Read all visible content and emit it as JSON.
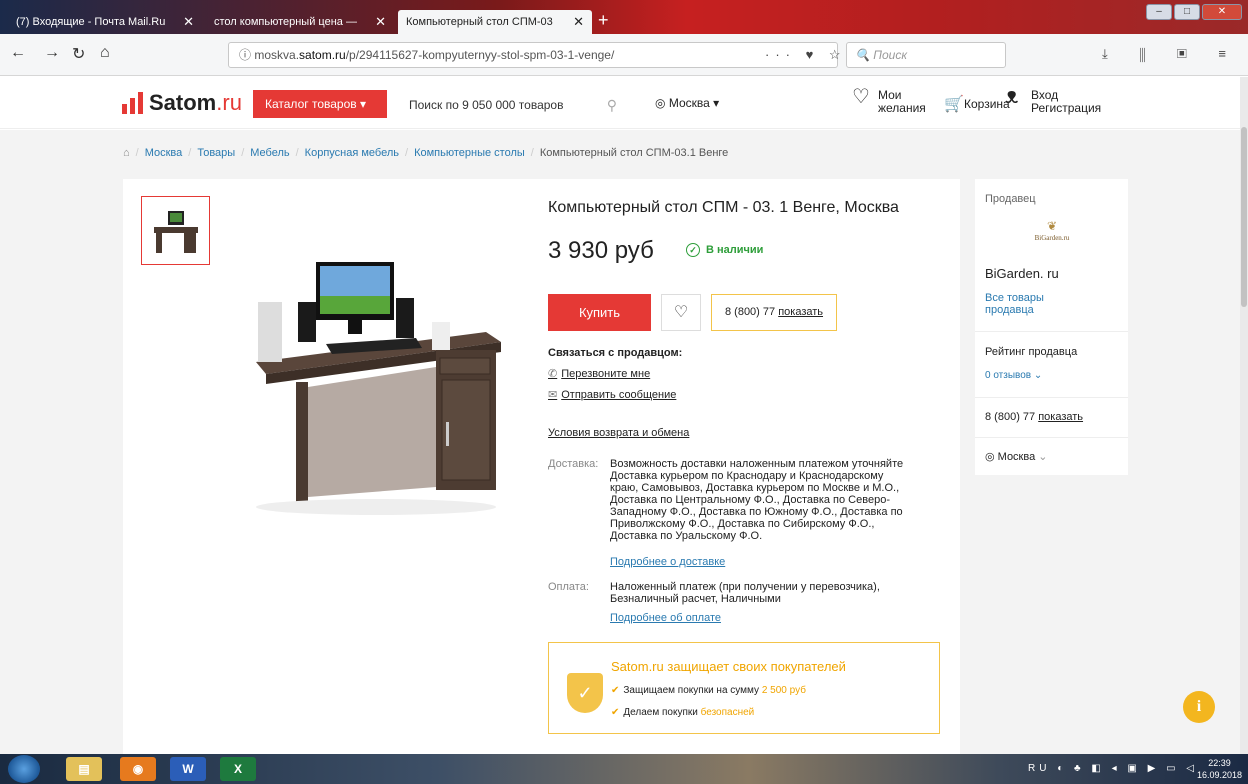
{
  "browser": {
    "tabs": [
      {
        "label": "(7) Входящие - Почта Mail.Ru",
        "close": "✕",
        "color": "#3b86d4"
      },
      {
        "label": "стол компьютерный цена — ",
        "close": "✕",
        "color": "#e53935"
      },
      {
        "label": "Компьютерный стол СПМ-03",
        "close": "✕",
        "color": "#e53935"
      }
    ],
    "new_tab": "+",
    "window_buttons": {
      "minimize": "–",
      "maximize": "□",
      "close": "✕"
    },
    "url_prefix": "moskva.",
    "url_domain": "satom.ru",
    "url_path": "/p/294115627-kompyuternyy-stol-spm-03-1-venge/",
    "url_icons": "··· ♥ ☆",
    "search_placeholder": "Поиск"
  },
  "header": {
    "logo_name": "Satom",
    "logo_suffix": ".ru",
    "catalog_label": "Каталог товаров ▾",
    "search_placeholder": "Поиск по 9 050 000 товаров",
    "city": "Москва ▾",
    "wishlist_line1": "Мои",
    "wishlist_line2": "желания",
    "cart": "Корзина",
    "login_line1": "Вход",
    "login_line2": "Регистрация"
  },
  "breadcrumb": [
    "Москва",
    "Товары",
    "Мебель",
    "Корпусная мебель",
    "Компьютерные столы"
  ],
  "breadcrumb_current": "Компьютерный стол СПМ-03.1 Венге",
  "product": {
    "title": "Компьютерный стол СПМ - 03. 1 Венге, Москва",
    "price": "3 930 руб",
    "stock": "В наличии",
    "buy": "Купить",
    "phone_number": "8 (800) 77",
    "phone_show": "показать",
    "contact_label": "Связаться с продавцом",
    "callback": "Перезвоните мне",
    "message": "Отправить сообщение",
    "terms": "Условия возврата и обмена",
    "delivery_label": "Доставка:",
    "delivery_lines": [
      "Возможность доставки наложенным платежом уточняйте",
      "Доставка курьером по Краснодару и Краснодарскому",
      "краю,  Самовывоз,  Доставка курьером по Москве и М.О.,",
      "Доставка по Центральному Ф.О.,  Доставка по Северо-",
      "Западному Ф.О.,  Доставка по Южному Ф.О.,  Доставка по",
      "Приволжскому Ф.О.,  Доставка по Сибирскому Ф.О.,",
      "Доставка по Уральскому Ф.О."
    ],
    "delivery_more": "Подробнее о доставке",
    "payment_label": "Оплата:",
    "payment_lines": [
      "Наложенный платеж (при получении у перевозчика),",
      "Безналичный расчет,  Наличными"
    ],
    "payment_more": "Подробнее об оплате",
    "protect_title": "Satom.ru защищает своих покупателей",
    "protect_line1": "Защищаем покупки на сумму ",
    "protect_line1_hl": "2 500 руб",
    "protect_line2": "Делаем покупки ",
    "protect_line2_hl": "безопасней"
  },
  "seller": {
    "label": "Продавец",
    "logo_text": "BiGarden.ru",
    "name": "BiGarden. ru",
    "all_goods_line1": "Все товары",
    "all_goods_line2": "продавца",
    "rating_label": "Рейтинг продавца",
    "reviews": "0 отзывов",
    "phone_number": "8 (800) 77",
    "phone_show": "показать",
    "city": "Москва"
  },
  "taskbar": {
    "lang": "RU",
    "time": "22:39",
    "date": "16.09.2018"
  }
}
